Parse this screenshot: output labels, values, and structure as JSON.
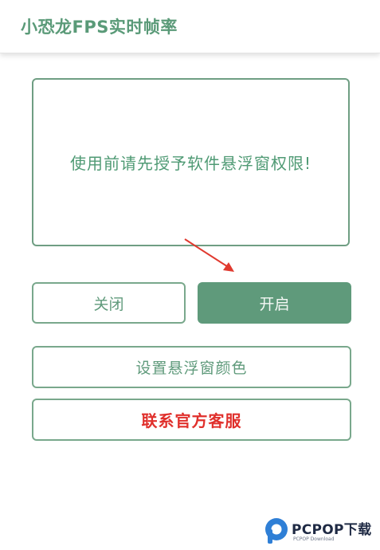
{
  "app": {
    "title": "小恐龙FPS实时帧率"
  },
  "message": {
    "text": "使用前请先授予软件悬浮窗权限!"
  },
  "buttons": {
    "close": "关闭",
    "open": "开启",
    "set_color": "设置悬浮窗颜色",
    "contact": "联系官方客服"
  },
  "watermark": {
    "brand": "PCPOP下载",
    "subtitle": "PCPOP Download"
  },
  "colors": {
    "accent": "#5f9a7b",
    "border": "#79a88c",
    "contact_text": "#e0302c",
    "arrow": "#e03a2f"
  }
}
